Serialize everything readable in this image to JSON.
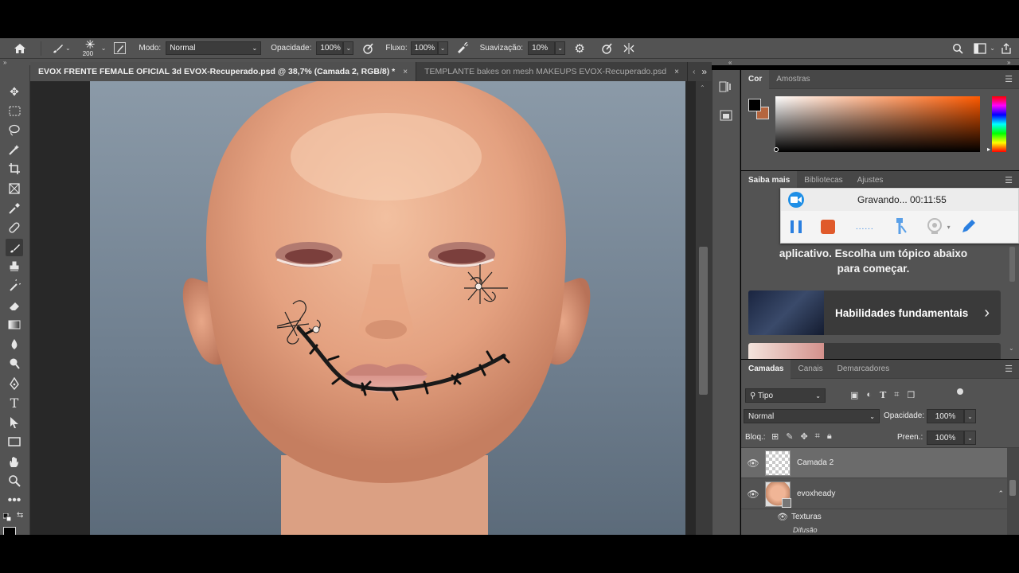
{
  "options_bar": {
    "brush_size": "200",
    "mode_label": "Modo:",
    "mode_value": "Normal",
    "opacity_label": "Opacidade:",
    "opacity_value": "100%",
    "flow_label": "Fluxo:",
    "flow_value": "100%",
    "smoothing_label": "Suavização:",
    "smoothing_value": "10%"
  },
  "tabs": [
    {
      "label": "EVOX FRENTE FEMALE OFICIAL 3d  EVOX-Recuperado.psd @ 38,7% (Camada 2, RGB/8) *",
      "close": "×"
    },
    {
      "label": "TEMPLANTE bakes on mesh MAKEUPS EVOX-Recuperado.psd",
      "close": "×"
    }
  ],
  "color_panel": {
    "tabs": [
      "Cor",
      "Amostras"
    ],
    "foreground": "#000000",
    "background": "#b5653e",
    "hue_color": "#ff5a00"
  },
  "learn_panel": {
    "tabs": [
      "Saiba mais",
      "Bibliotecas",
      "Ajustes"
    ],
    "intro_text": "aplicativo. Escolha um tópico abaixo para começar.",
    "card1_title": "Habilidades fundamentais",
    "card1_chevron": "›"
  },
  "recorder": {
    "status": "Gravando... 00:11:55",
    "dots": "......"
  },
  "layers_panel": {
    "tabs": [
      "Camadas",
      "Canais",
      "Demarcadores"
    ],
    "filter_value": "Tipo",
    "blend_mode": "Normal",
    "opacity_label": "Opacidade:",
    "opacity_value": "100%",
    "lock_label": "Bloq.:",
    "fill_label": "Preen.:",
    "fill_value": "100%",
    "layers": [
      {
        "name": "Camada 2"
      },
      {
        "name": "evoxheady"
      }
    ],
    "sub_textures": "Texturas",
    "sub_diffuse": "Difusão"
  }
}
